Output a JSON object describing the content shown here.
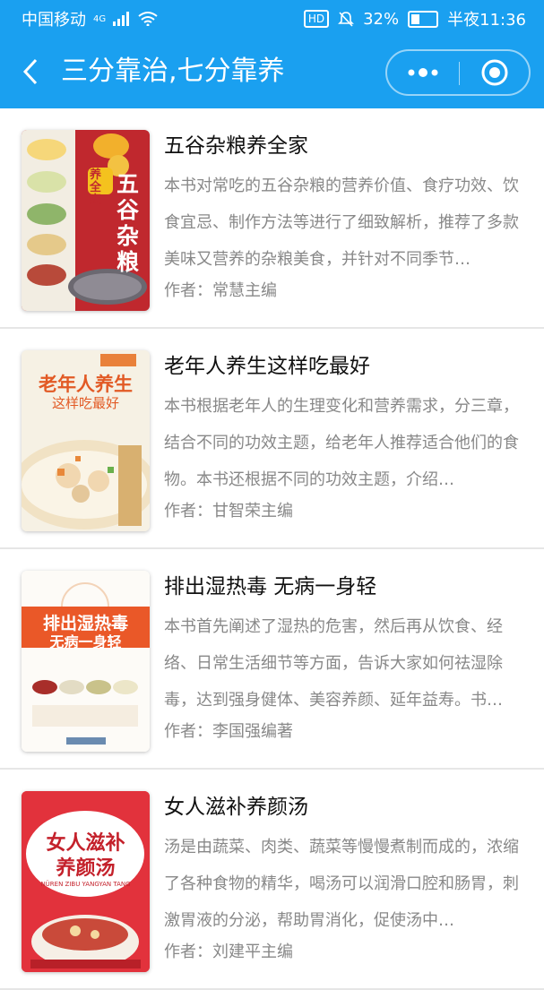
{
  "status": {
    "carrier": "中国移动",
    "network": "4G",
    "battery_percent": "32%",
    "time": "半夜11:36"
  },
  "nav": {
    "title": "三分靠治,七分靠养"
  },
  "books": [
    {
      "title": "五谷杂粮养全家",
      "desc": "本书对常吃的五谷杂粮的营养价值、食疗功效、饮食宜忌、制作方法等进行了细致解析，推荐了多款美味又营养的杂粮美食，并针对不同季节…",
      "author": "作者：常慧主编",
      "cover": {
        "big_text": "五谷杂粮",
        "badge": "养全家",
        "bg": "#c0282e"
      }
    },
    {
      "title": "老年人养生这样吃最好",
      "desc": "本书根据老年人的生理变化和营养需求，分三章，结合不同的功效主题，给老年人推荐适合他们的食物。本书还根据不同的功效主题，介绍…",
      "author": "作者：甘智荣主编",
      "cover": {
        "line1": "老年人养生",
        "line2": "这样吃最好",
        "bg": "#f4f0e6"
      }
    },
    {
      "title": "排出湿热毒 无病一身轻",
      "desc": "本书首先阐述了湿热的危害，然后再从饮食、经络、日常生活细节等方面，告诉大家如何祛湿除毒，达到强身健体、美容养颜、延年益寿。书…",
      "author": "作者：李国强编著",
      "cover": {
        "line1": "排出湿热毒",
        "line2": "无病一身轻",
        "bg": "#e8502c"
      }
    },
    {
      "title": "女人滋补养颜汤",
      "desc": "汤是由蔬菜、肉类、蔬菜等慢慢煮制而成的，浓缩了各种食物的精华，喝汤可以润滑口腔和肠胃，刺激胃液的分泌，帮助胃消化，促使汤中…",
      "author": "作者：刘建平主编",
      "cover": {
        "line1": "女人滋补",
        "line2": "养颜汤",
        "pinyin": "NÜREN ZIBU YANGYAN TANG",
        "bg": "#e2323c"
      }
    }
  ]
}
